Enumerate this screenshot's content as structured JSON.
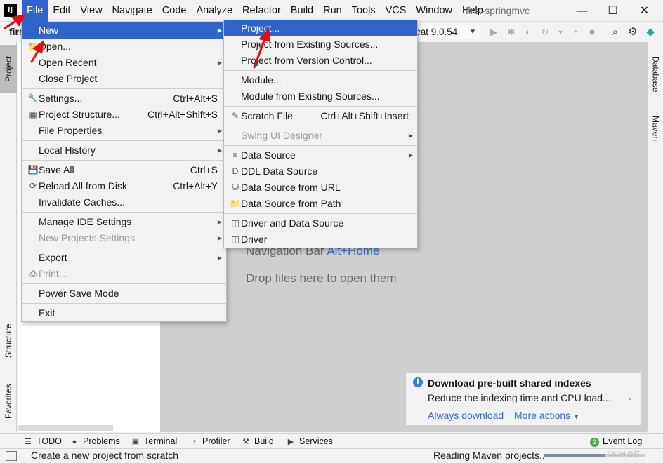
{
  "menubar": {
    "app_logo": "IJ",
    "items": [
      "File",
      "Edit",
      "View",
      "Navigate",
      "Code",
      "Analyze",
      "Refactor",
      "Build",
      "Run",
      "Tools",
      "VCS",
      "Window",
      "Help"
    ],
    "active": "File",
    "project_title": "first-springmvc"
  },
  "window_controls": {
    "minimize": "—",
    "maximize": "☐",
    "close": "✕"
  },
  "toolbar": {
    "breadcrumb_fragment": "firs",
    "run_config": "cat 9.0.54"
  },
  "left_stripe": {
    "project": "Project",
    "structure": "Structure",
    "favorites": "Favorites"
  },
  "right_stripe": {
    "database": "Database",
    "maven": "Maven"
  },
  "file_menu": {
    "items": [
      {
        "label": "New",
        "icon": "",
        "shortcut": "",
        "submenu": true,
        "highlighted": true
      },
      {
        "label": "Open...",
        "icon": "folder-icon",
        "shortcut": ""
      },
      {
        "label": "Open Recent",
        "icon": "",
        "shortcut": "",
        "submenu": true
      },
      {
        "label": "Close Project",
        "icon": "",
        "shortcut": ""
      },
      {
        "separator": true
      },
      {
        "label": "Settings...",
        "icon": "wrench-icon",
        "shortcut": "Ctrl+Alt+S"
      },
      {
        "label": "Project Structure...",
        "icon": "project-structure-icon",
        "shortcut": "Ctrl+Alt+Shift+S"
      },
      {
        "label": "File Properties",
        "icon": "",
        "shortcut": "",
        "submenu": true
      },
      {
        "separator": true
      },
      {
        "label": "Local History",
        "icon": "",
        "shortcut": "",
        "submenu": true
      },
      {
        "separator": true
      },
      {
        "label": "Save All",
        "icon": "save-icon",
        "shortcut": "Ctrl+S"
      },
      {
        "label": "Reload All from Disk",
        "icon": "reload-icon",
        "shortcut": "Ctrl+Alt+Y"
      },
      {
        "label": "Invalidate Caches...",
        "icon": "",
        "shortcut": ""
      },
      {
        "separator": true
      },
      {
        "label": "Manage IDE Settings",
        "icon": "",
        "shortcut": "",
        "submenu": true
      },
      {
        "label": "New Projects Settings",
        "icon": "",
        "shortcut": "",
        "submenu": true,
        "disabled": true
      },
      {
        "separator": true
      },
      {
        "label": "Export",
        "icon": "",
        "shortcut": "",
        "submenu": true
      },
      {
        "label": "Print...",
        "icon": "printer-icon",
        "shortcut": "",
        "disabled": true
      },
      {
        "separator": true
      },
      {
        "label": "Power Save Mode",
        "icon": "",
        "shortcut": ""
      },
      {
        "separator": true
      },
      {
        "label": "Exit",
        "icon": "",
        "shortcut": ""
      }
    ]
  },
  "new_submenu": {
    "items": [
      {
        "label": "Project...",
        "icon": "",
        "shortcut": "",
        "highlighted": true
      },
      {
        "label": "Project from Existing Sources...",
        "icon": "",
        "shortcut": ""
      },
      {
        "label": "Project from Version Control...",
        "icon": "",
        "shortcut": ""
      },
      {
        "separator": true
      },
      {
        "label": "Module...",
        "icon": "",
        "shortcut": ""
      },
      {
        "label": "Module from Existing Sources...",
        "icon": "",
        "shortcut": ""
      },
      {
        "separator": true
      },
      {
        "label": "Scratch File",
        "icon": "scratch-file-icon",
        "shortcut": "Ctrl+Alt+Shift+Insert"
      },
      {
        "separator": true
      },
      {
        "label": "Swing UI Designer",
        "icon": "",
        "shortcut": "",
        "submenu": true,
        "disabled": true
      },
      {
        "separator": true
      },
      {
        "label": "Data Source",
        "icon": "database-icon",
        "shortcut": "",
        "submenu": true
      },
      {
        "label": "DDL Data Source",
        "icon": "ddl-icon",
        "shortcut": ""
      },
      {
        "label": "Data Source from URL",
        "icon": "database-url-icon",
        "shortcut": ""
      },
      {
        "label": "Data Source from Path",
        "icon": "folder-icon",
        "shortcut": ""
      },
      {
        "separator": true
      },
      {
        "label": "Driver and Data Source",
        "icon": "driver-datasource-icon",
        "shortcut": ""
      },
      {
        "label": "Driver",
        "icon": "driver-icon",
        "shortcut": ""
      }
    ]
  },
  "editor": {
    "nav_hint": "Navigation Bar",
    "nav_shortcut": "Alt+Home",
    "drop_hint": "Drop files here to open them"
  },
  "notification": {
    "title": "Download pre-built shared indexes",
    "body": "Reduce the indexing time and CPU load...",
    "action_primary": "Always download",
    "action_more": "More actions"
  },
  "tool_windows": {
    "todo": "TODO",
    "problems": "Problems",
    "terminal": "Terminal",
    "profiler": "Profiler",
    "build": "Build",
    "services": "Services",
    "event_log_count": "2",
    "event_log": "Event Log"
  },
  "status": {
    "message": "Create a new project from scratch",
    "progress_text": "Reading Maven projects..",
    "progress_fraction": 0.6
  },
  "watermark": "CSDN @打"
}
